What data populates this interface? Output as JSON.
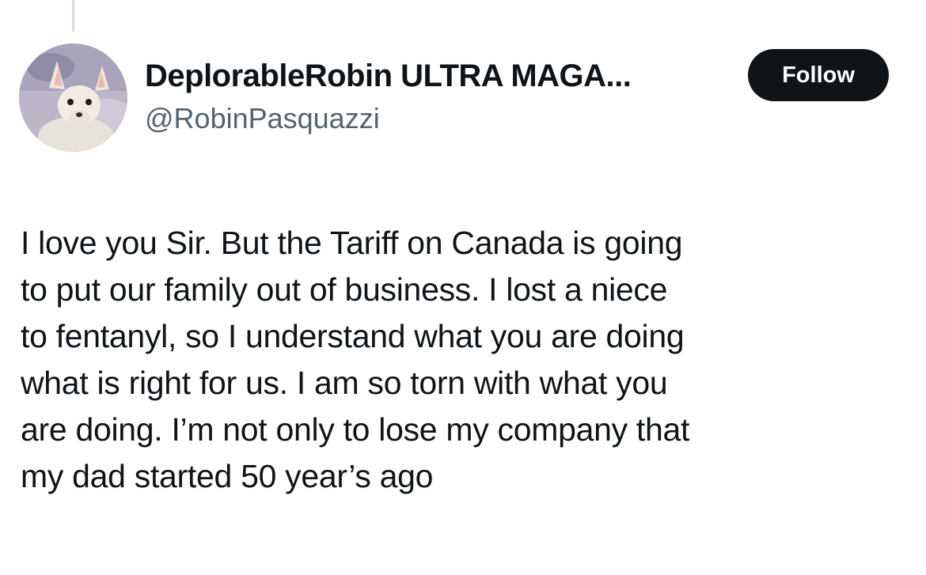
{
  "author": {
    "display_name": "DeplorableRobin ULTRA MAGA...",
    "handle": "@RobinPasquazzi",
    "avatar_icon": "chihuahua-avatar"
  },
  "follow_button": {
    "label": "Follow"
  },
  "post": {
    "lines": [
      "I love you Sir. But the Tariff on Canada is going",
      "to put our family out of business.  I lost a niece",
      "to fentanyl, so I understand what you are doing",
      "what is right for us. I am so torn with what you",
      "are doing. I’m not only to lose my company that",
      "my dad started 50 year’s ago"
    ]
  },
  "colors": {
    "text": "#0f1419",
    "secondary_text": "#536471",
    "button_bg": "#0f1419",
    "button_text": "#ffffff",
    "thread_line": "#cfd9de"
  }
}
